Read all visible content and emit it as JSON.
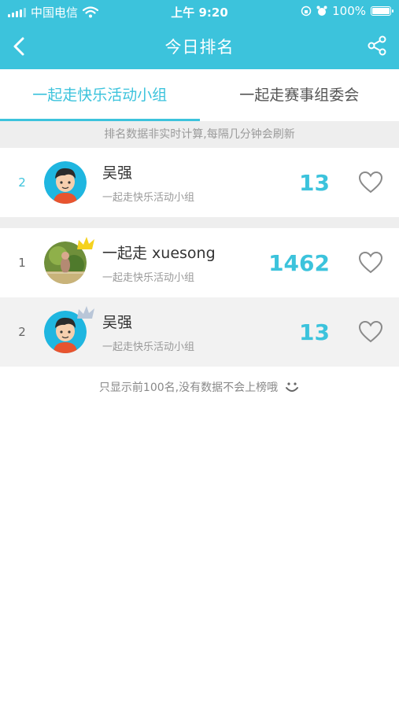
{
  "status_bar": {
    "carrier": "中国电信",
    "time": "上午 9:20",
    "battery": "100%",
    "battery_level": 1.0
  },
  "nav": {
    "title": "今日排名",
    "back_icon": "chevron-left-icon",
    "share_icon": "share-icon"
  },
  "tabs": [
    {
      "label": "一起走快乐活动小组",
      "active": true
    },
    {
      "label": "一起走赛事组委会",
      "active": false
    }
  ],
  "notice": "排名数据非实时计算,每隔几分钟会刷新",
  "my_rank": {
    "rank": "2",
    "name": "吴强",
    "group": "一起走快乐活动小组",
    "score": "13"
  },
  "ranking": [
    {
      "rank": "1",
      "name": "一起走 xuesong",
      "group": "一起走快乐活动小组",
      "score": "1462",
      "badge": "gold-crown-icon"
    },
    {
      "rank": "2",
      "name": "吴强",
      "group": "一起走快乐活动小组",
      "score": "13",
      "badge": "silver-crown-icon"
    }
  ],
  "footer": "只显示前100名,没有数据不会上榜哦",
  "colors": {
    "accent": "#3cc3dc",
    "gold": "#f5d21e",
    "silver": "#b9c6d8"
  }
}
